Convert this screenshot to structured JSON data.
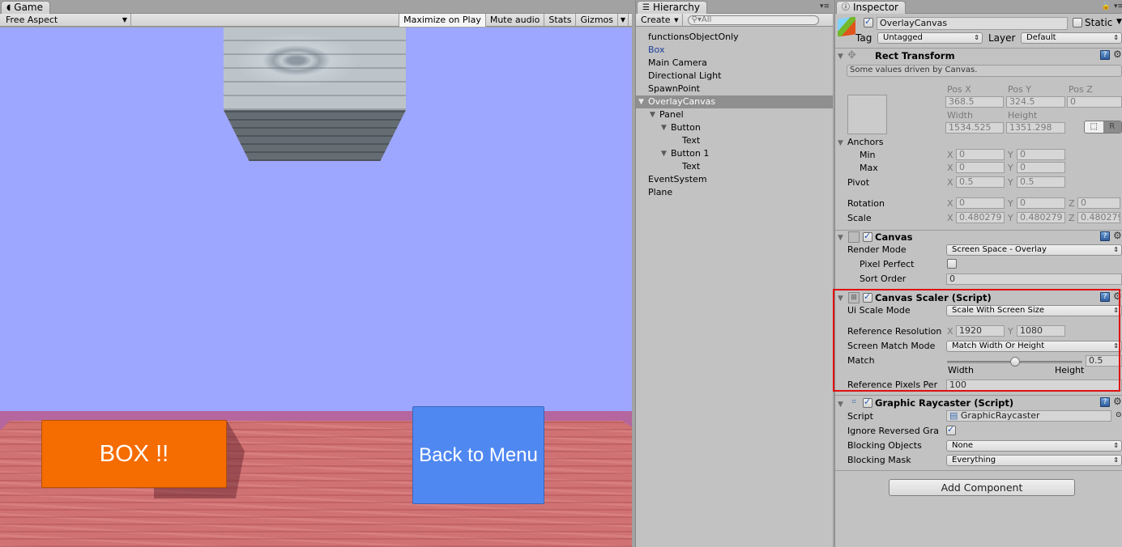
{
  "game": {
    "tab_label": "Game",
    "aspect": "Free Aspect",
    "toolbar": {
      "maximize_on_play": "Maximize on Play",
      "mute_audio": "Mute audio",
      "stats": "Stats",
      "gizmos": "Gizmos"
    },
    "scene": {
      "sky_color": "#9ea7ff",
      "buttons": [
        {
          "label": "BOX !!",
          "color": "#f56c00"
        },
        {
          "label": "Back to Menu",
          "color": "#5088f2"
        }
      ]
    }
  },
  "hierarchy": {
    "tab_label": "Hierarchy",
    "create_label": "Create",
    "search_placeholder": "All",
    "items": [
      {
        "label": "functionsObjectOnly",
        "depth": 0
      },
      {
        "label": "Box",
        "depth": 0,
        "prefab": true
      },
      {
        "label": "Main Camera",
        "depth": 0
      },
      {
        "label": "Directional Light",
        "depth": 0
      },
      {
        "label": "SpawnPoint",
        "depth": 0
      },
      {
        "label": "OverlayCanvas",
        "depth": 0,
        "expanded": true,
        "selected": true
      },
      {
        "label": "Panel",
        "depth": 1,
        "expanded": true
      },
      {
        "label": "Button",
        "depth": 2,
        "expanded": true
      },
      {
        "label": "Text",
        "depth": 3
      },
      {
        "label": "Button 1",
        "depth": 2,
        "expanded": true
      },
      {
        "label": "Text",
        "depth": 3
      },
      {
        "label": "EventSystem",
        "depth": 0
      },
      {
        "label": "Plane",
        "depth": 0
      }
    ]
  },
  "inspector": {
    "tab_label": "Inspector",
    "object_name": "OverlayCanvas",
    "active": true,
    "static_label": "Static",
    "static": false,
    "tag_label": "Tag",
    "tag_value": "Untagged",
    "layer_label": "Layer",
    "layer_value": "Default",
    "rect_transform": {
      "title": "Rect Transform",
      "info": "Some values driven by Canvas.",
      "pos_x_label": "Pos X",
      "pos_x": "368.5",
      "pos_y_label": "Pos Y",
      "pos_y": "324.5",
      "pos_z_label": "Pos Z",
      "pos_z": "0",
      "width_label": "Width",
      "width": "1534.525",
      "height_label": "Height",
      "height": "1351.298",
      "anchors_label": "Anchors",
      "min_label": "Min",
      "min_x": "0",
      "min_y": "0",
      "max_label": "Max",
      "max_x": "0",
      "max_y": "0",
      "pivot_label": "Pivot",
      "pivot_x": "0.5",
      "pivot_y": "0.5",
      "rotation_label": "Rotation",
      "rot_x": "0",
      "rot_y": "0",
      "rot_z": "0",
      "scale_label": "Scale",
      "scale_x": "0.480279",
      "scale_y": "0.480279",
      "scale_z": "0.480279",
      "x": "X",
      "y": "Y",
      "z": "Z",
      "raw_button": "R"
    },
    "canvas": {
      "title": "Canvas",
      "enabled": true,
      "render_mode_label": "Render Mode",
      "render_mode": "Screen Space - Overlay",
      "pixel_perfect_label": "Pixel Perfect",
      "pixel_perfect": false,
      "sort_order_label": "Sort Order",
      "sort_order": "0"
    },
    "canvas_scaler": {
      "title": "Canvas Scaler (Script)",
      "enabled": true,
      "ui_scale_mode_label": "Ui Scale Mode",
      "ui_scale_mode": "Scale With Screen Size",
      "ref_res_label": "Reference Resolution",
      "ref_res_x": "1920",
      "ref_res_y": "1080",
      "match_mode_label": "Screen Match Mode",
      "match_mode": "Match Width Or Height",
      "match_label": "Match",
      "match_value": "0.5",
      "match_fraction": 0.5,
      "match_min_label": "Width",
      "match_max_label": "Height",
      "ref_ppu_label": "Reference Pixels Per",
      "ref_ppu": "100",
      "highlight_color": "#e01010"
    },
    "graphic_raycaster": {
      "title": "Graphic Raycaster (Script)",
      "enabled": true,
      "script_label": "Script",
      "script_value": "GraphicRaycaster",
      "ignore_reversed_label": "Ignore Reversed Gra",
      "ignore_reversed": true,
      "blocking_objects_label": "Blocking Objects",
      "blocking_objects": "None",
      "blocking_mask_label": "Blocking Mask",
      "blocking_mask": "Everything"
    },
    "add_component": "Add Component"
  }
}
